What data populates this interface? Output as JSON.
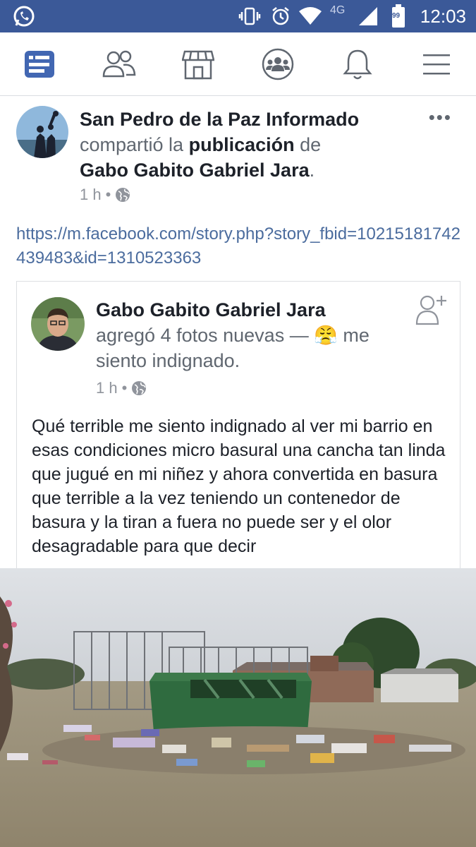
{
  "status_bar": {
    "time": "12:03",
    "network": "4G",
    "battery": "99",
    "icons": [
      "whatsapp-icon",
      "vibrate-icon",
      "alarm-icon",
      "wifi-icon",
      "signal-icon",
      "battery-icon"
    ]
  },
  "nav": {
    "items": [
      {
        "name": "news-feed",
        "icon": "news-feed-icon",
        "active": true
      },
      {
        "name": "friends",
        "icon": "friends-icon",
        "active": false
      },
      {
        "name": "marketplace",
        "icon": "marketplace-icon",
        "active": false
      },
      {
        "name": "groups",
        "icon": "groups-icon",
        "active": false
      },
      {
        "name": "notifications",
        "icon": "bell-icon",
        "active": false
      },
      {
        "name": "menu",
        "icon": "menu-icon",
        "active": false
      }
    ],
    "active_color": "#4267b2",
    "inactive_color": "#606770"
  },
  "post": {
    "page_name": "San Pedro de la Paz Informado",
    "shared_text": "compartió la",
    "shared_object": "publicación",
    "shared_of": "de",
    "original_author": "Gabo Gabito Gabriel Jara",
    "period": ".",
    "time": "1 h",
    "dot": "•",
    "more": "•••",
    "link": "https://m.facebook.com/story.php?story_fbid=10215181742439483&id=1310523363"
  },
  "shared": {
    "author": "Gabo Gabito Gabriel Jara",
    "action": "agregó 4 fotos nuevas —",
    "feeling_emoji": "😤",
    "feeling": "me siento indignado.",
    "time": "1 h",
    "dot": "•",
    "body": "Qué terrible me siento indignado al ver mi barrio en esas condiciones micro basural una cancha tan linda que jugué en mi niñez y ahora convertida en basura que terrible a la vez teniendo un contenedor de basura y la tiran a fuera no puede ser y el olor desagradable para que decir"
  },
  "colors": {
    "brand": "#3b5998",
    "link": "#4b6c9e",
    "meta": "#90949c",
    "container": "#2f6b3f"
  }
}
